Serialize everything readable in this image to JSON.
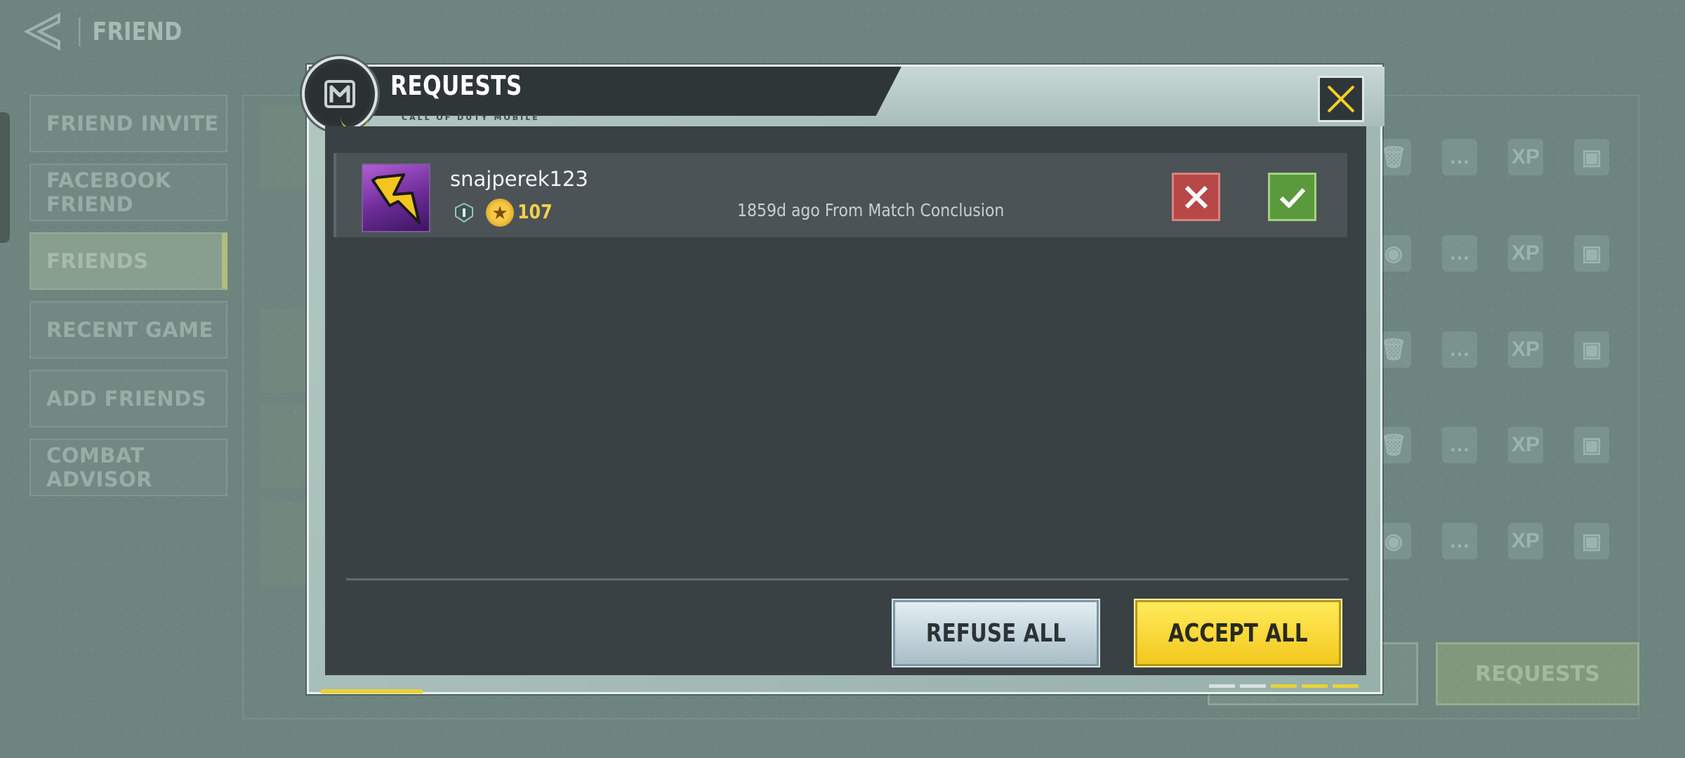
{
  "background": {
    "screen_title": "FRIEND",
    "nav_items": [
      {
        "label": "FRIEND INVITE",
        "active": false
      },
      {
        "label": "FACEBOOK FRIEND",
        "active": false
      },
      {
        "label": "FRIENDS",
        "active": true
      },
      {
        "label": "RECENT GAME",
        "active": false
      },
      {
        "label": "ADD FRIENDS",
        "active": false
      },
      {
        "label": "COMBAT ADVISOR",
        "active": false
      }
    ],
    "requests_button_label": "REQUESTS"
  },
  "modal": {
    "title": "REQUESTS",
    "subtitle": "CALL OF DUTY MOBILE",
    "requests": [
      {
        "player_name": "snajperek123",
        "level": "107",
        "info": "1859d ago From Match Conclusion",
        "avatar_icon": "lightning-bolt-icon",
        "rank_icon": "rank-shield-icon"
      }
    ],
    "refuse_all_label": "REFUSE ALL",
    "accept_all_label": "ACCEPT ALL"
  },
  "colors": {
    "accent_yellow": "#f2c81e",
    "reject_red": "#b84848",
    "accept_green": "#5b9a3c",
    "panel_dark": "#3a4144"
  }
}
